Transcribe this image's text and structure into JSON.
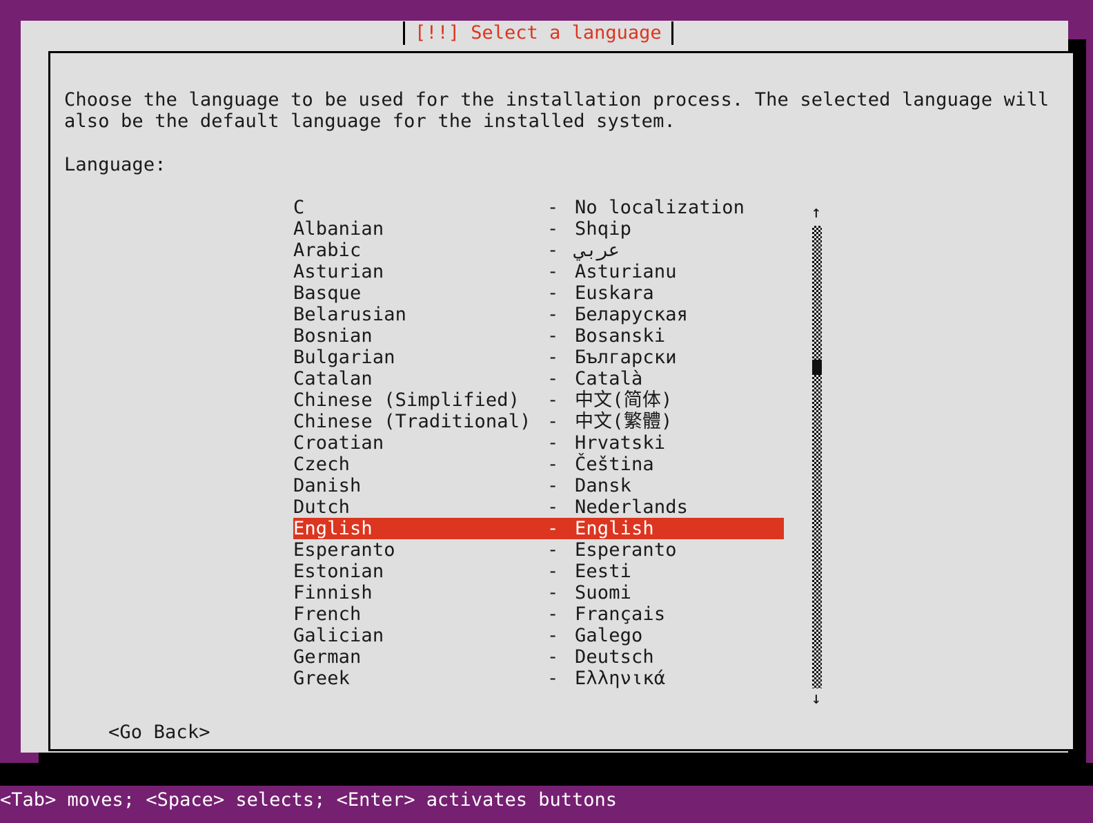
{
  "window": {
    "title": "[!!] Select a language",
    "title_color": "#dc3520",
    "background_color": "#762072",
    "dialog_color": "#dfdfdf",
    "highlight_color": "#dc3520"
  },
  "body": {
    "description": "Choose the language to be used for the installation process. The selected language will\nalso be the default language for the installed system.",
    "field_label": "Language:"
  },
  "list": {
    "separator": "-",
    "items": [
      {
        "name": "C",
        "native": "No localization",
        "selected": false
      },
      {
        "name": "Albanian",
        "native": "Shqip",
        "selected": false
      },
      {
        "name": "Arabic",
        "native": "عربي",
        "selected": false
      },
      {
        "name": "Asturian",
        "native": "Asturianu",
        "selected": false
      },
      {
        "name": "Basque",
        "native": "Euskara",
        "selected": false
      },
      {
        "name": "Belarusian",
        "native": "Беларуская",
        "selected": false
      },
      {
        "name": "Bosnian",
        "native": "Bosanski",
        "selected": false
      },
      {
        "name": "Bulgarian",
        "native": "Български",
        "selected": false
      },
      {
        "name": "Catalan",
        "native": "Català",
        "selected": false
      },
      {
        "name": "Chinese (Simplified)",
        "native": "中文(简体)",
        "selected": false
      },
      {
        "name": "Chinese (Traditional)",
        "native": "中文(繁體)",
        "selected": false
      },
      {
        "name": "Croatian",
        "native": "Hrvatski",
        "selected": false
      },
      {
        "name": "Czech",
        "native": "Čeština",
        "selected": false
      },
      {
        "name": "Danish",
        "native": "Dansk",
        "selected": false
      },
      {
        "name": "Dutch",
        "native": "Nederlands",
        "selected": false
      },
      {
        "name": "English",
        "native": "English",
        "selected": true
      },
      {
        "name": "Esperanto",
        "native": "Esperanto",
        "selected": false
      },
      {
        "name": "Estonian",
        "native": "Eesti",
        "selected": false
      },
      {
        "name": "Finnish",
        "native": "Suomi",
        "selected": false
      },
      {
        "name": "French",
        "native": "Français",
        "selected": false
      },
      {
        "name": "Galician",
        "native": "Galego",
        "selected": false
      },
      {
        "name": "German",
        "native": "Deutsch",
        "selected": false
      },
      {
        "name": "Greek",
        "native": "Ελληνικά",
        "selected": false
      }
    ]
  },
  "scrollbar": {
    "up_arrow": "↑",
    "down_arrow": "↓",
    "thumb_position_percent": 30
  },
  "buttons": {
    "go_back": "<Go Back>"
  },
  "status_bar": {
    "text": "<Tab> moves; <Space> selects; <Enter> activates buttons"
  }
}
